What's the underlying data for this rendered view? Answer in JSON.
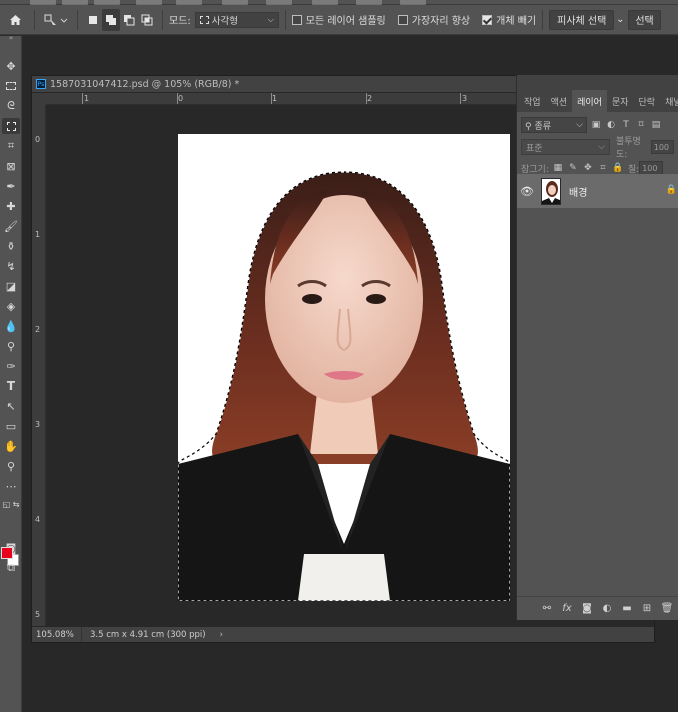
{
  "options_bar": {
    "mode_label": "모드:",
    "mode_value": "사각형",
    "sample_all_layers": "모든 레이어 샘플링",
    "enhance_edge": "가장자리 향상",
    "object_subtract": "개체 빼기",
    "select_subject": "피사체 선택",
    "select_and_mask": "선택"
  },
  "document": {
    "tab_title": "1587031047412.psd @ 105% (RGB/8) *",
    "ruler_h": [
      "1",
      "0",
      "1",
      "2",
      "3"
    ],
    "ruler_v": [
      "0",
      "1",
      "2",
      "3",
      "4",
      "5"
    ],
    "zoom": "105.08%",
    "doc_info": "3.5 cm x 4.91 cm (300 ppi)",
    "status_arrow": "›"
  },
  "colors": {
    "foreground": "#e8001c",
    "background": "#ffffff"
  },
  "layers_panel": {
    "tabs": [
      {
        "label": "작업",
        "active": false
      },
      {
        "label": "액션",
        "active": false
      },
      {
        "label": "레이어",
        "active": true
      },
      {
        "label": "문자",
        "active": false
      },
      {
        "label": "단락",
        "active": false
      },
      {
        "label": "채널",
        "active": false
      }
    ],
    "filter_label": "종류",
    "blend_mode": "표준",
    "opacity_label": "불투명도:",
    "opacity_value": "100",
    "lock_label": "잠그기:",
    "fill_label": "칠:",
    "fill_value": "100",
    "layers": [
      {
        "name": "배경",
        "visible": true,
        "locked": true
      }
    ]
  }
}
